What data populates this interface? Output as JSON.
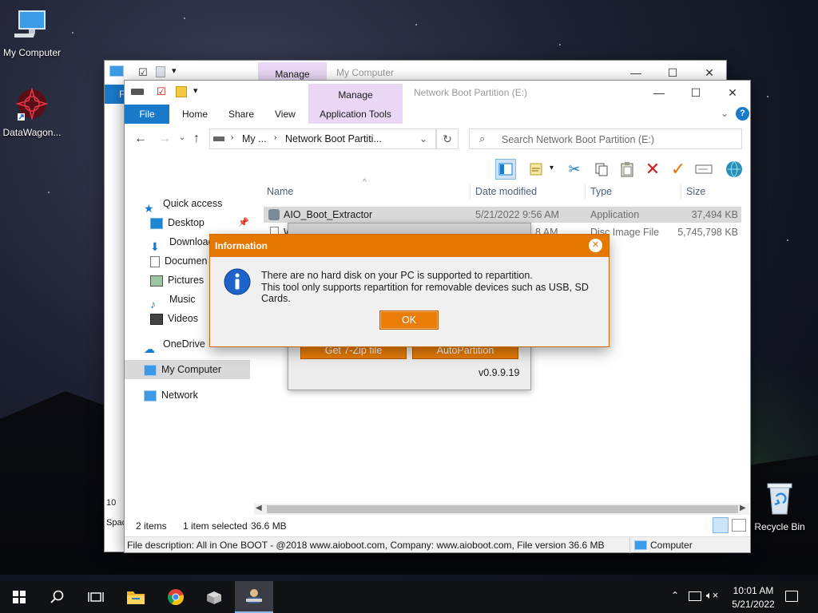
{
  "desktop": {
    "icons": [
      {
        "label": "My Computer"
      },
      {
        "label": "DataWagon..."
      },
      {
        "label": "Recycle Bin"
      }
    ]
  },
  "back_window": {
    "manage_tab": "Manage",
    "title": "My Computer",
    "left_letter": "F",
    "status_left": "10",
    "status_left2": "Spac"
  },
  "explorer": {
    "manage_tab": "Manage",
    "app_tools_tab": "Application Tools",
    "title": "Network Boot Partition (E:)",
    "tabs": [
      "File",
      "Home",
      "Share",
      "View"
    ],
    "address": {
      "part1": "My ...",
      "part2": "Network Boot Partiti..."
    },
    "search_placeholder": "Search Network Boot Partition (E:)",
    "nav": {
      "quick_access": "Quick access",
      "desktop": "Desktop",
      "downloads": "Download",
      "documents": "Documen",
      "pictures": "Pictures",
      "music": "Music",
      "videos": "Videos",
      "onedrive": "OneDrive",
      "my_computer": "My Computer",
      "network": "Network"
    },
    "columns": {
      "name": "Name",
      "date": "Date modified",
      "type": "Type",
      "size": "Size"
    },
    "files": [
      {
        "name": "AIO_Boot_Extractor",
        "date": "5/21/2022 9:56 AM",
        "type": "Application",
        "size": "37,494 KB"
      },
      {
        "name": "W",
        "date": "8 AM",
        "type": "Disc Image File",
        "size": "5,745,798 KB"
      }
    ],
    "status": {
      "items": "2 items",
      "selected": "1 item selected",
      "size": "36.6 MB"
    },
    "file_description": "File description: All in One BOOT - @2018 www.aioboot.com, Company: www.aioboot.com, File version 36.6 MB",
    "location": "Computer"
  },
  "aio_window": {
    "btn_7zip": "Get 7-Zip file",
    "btn_autopartition": "AutoPartition",
    "version": "v0.9.9.19"
  },
  "dialog": {
    "title": "Information",
    "line1": "There are no hard disk on your PC is supported to repartition.",
    "line2": "This tool only supports repartition for removable devices such as USB, SD Cards.",
    "ok": "OK"
  },
  "taskbar": {
    "time": "10:01 AM",
    "date": "5/21/2022"
  },
  "colors": {
    "accent_blue": "#1979ca",
    "dialog_orange": "#e57800",
    "manage_tab": "#e9d7f5"
  }
}
